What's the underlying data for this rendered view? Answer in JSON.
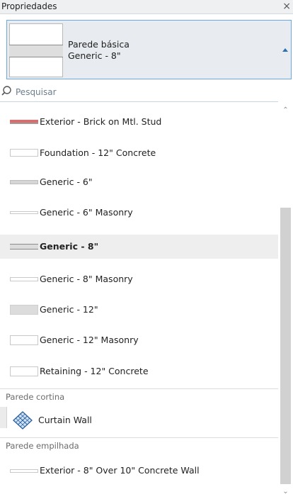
{
  "panel": {
    "title": "Propriedades",
    "close_glyph": "×"
  },
  "selector": {
    "family": "Parede básica",
    "type": "Generic - 8\""
  },
  "search": {
    "placeholder": "Pesquisar",
    "value": ""
  },
  "groups": {
    "basic_items": [
      {
        "label": "Exterior - Brick on Mtl. Stud",
        "swatch": "brick"
      },
      {
        "label": "Foundation - 12\" Concrete",
        "swatch": "found"
      },
      {
        "label": "Generic - 6\"",
        "swatch": "g6"
      },
      {
        "label": "Generic - 6\" Masonry",
        "swatch": "g6m"
      },
      {
        "label": "Generic - 8\"",
        "swatch": "g8",
        "selected": true
      },
      {
        "label": "Generic - 8\" Masonry",
        "swatch": "g8m"
      },
      {
        "label": "Generic - 12\"",
        "swatch": "g12"
      },
      {
        "label": "Generic - 12\" Masonry",
        "swatch": "g12m"
      },
      {
        "label": "Retaining - 12\" Concrete",
        "swatch": "ret"
      }
    ],
    "curtain_header": "Parede cortina",
    "curtain_items": [
      {
        "label": "Curtain Wall",
        "icon": "curtain-wall-icon"
      }
    ],
    "stacked_header": "Parede empilhada",
    "stacked_items": [
      {
        "label": "Exterior - 8\" Over 10\" Concrete Wall",
        "swatch": "stack"
      }
    ]
  },
  "colors": {
    "accent": "#2c6fb5",
    "selected_row": "#eeeeee",
    "brick": "#dd6b6b"
  }
}
